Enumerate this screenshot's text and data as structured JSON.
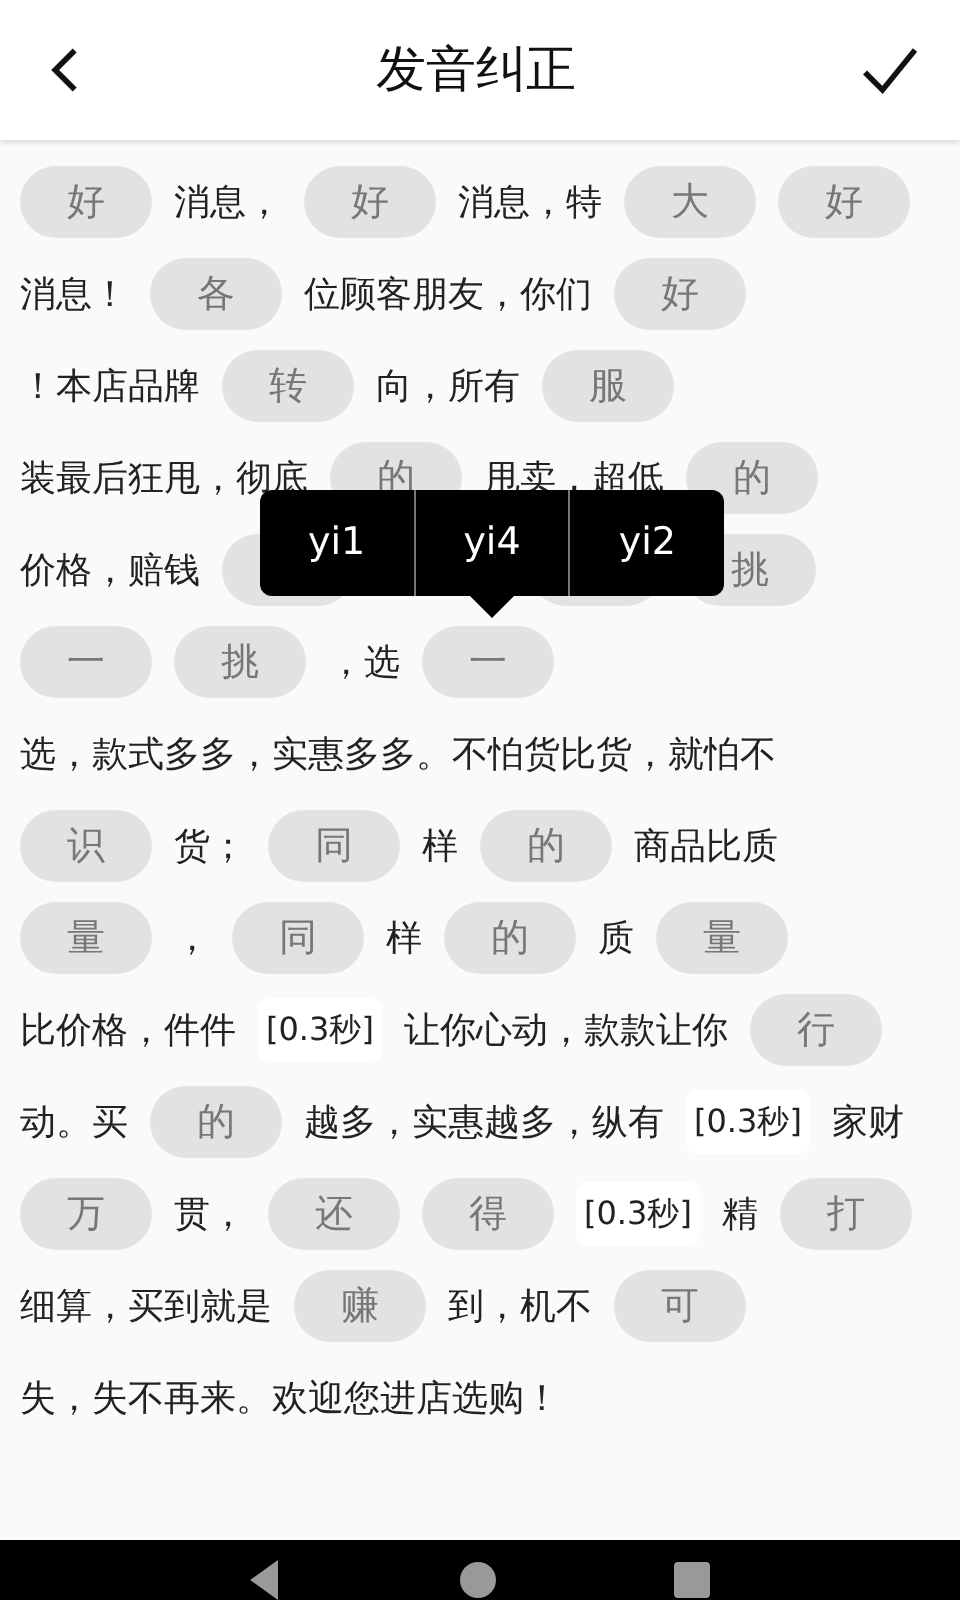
{
  "header": {
    "title": "发音纠正"
  },
  "lines": [
    [
      {
        "kind": "word",
        "text": "好"
      },
      {
        "kind": "text",
        "text": "消息，"
      },
      {
        "kind": "word",
        "text": "好"
      },
      {
        "kind": "text",
        "text": "消息，特"
      },
      {
        "kind": "word",
        "text": "大"
      },
      {
        "kind": "word",
        "text": "好"
      }
    ],
    [
      {
        "kind": "text",
        "text": "消息！"
      },
      {
        "kind": "word",
        "text": "各"
      },
      {
        "kind": "text",
        "text": "位顾客朋友，你们"
      },
      {
        "kind": "word",
        "text": "好"
      }
    ],
    [
      {
        "kind": "text",
        "text": "！本店品牌"
      },
      {
        "kind": "word",
        "text": "转"
      },
      {
        "kind": "text",
        "text": "向，所有"
      },
      {
        "kind": "word",
        "text": "服"
      }
    ],
    [
      {
        "kind": "text",
        "text": "装最后狂甩，彻底"
      },
      {
        "kind": "word",
        "text": "的"
      },
      {
        "kind": "text",
        "text": "甩卖，超低"
      },
      {
        "kind": "word",
        "text": "的"
      }
    ],
    [
      {
        "kind": "text",
        "text": "价格，赔钱"
      },
      {
        "kind": "word"
      },
      {
        "kind": "covered"
      },
      {
        "kind": "word"
      },
      {
        "kind": "word",
        "text": "挑"
      }
    ],
    [
      {
        "kind": "word",
        "text": "一"
      },
      {
        "kind": "word",
        "text": "挑"
      },
      {
        "kind": "text",
        "text": "，选"
      },
      {
        "kind": "word",
        "text": "一"
      }
    ],
    [
      {
        "kind": "text",
        "text": "选，款式多多，实惠多多。不怕货比货，就怕不"
      }
    ],
    [
      {
        "kind": "word",
        "text": "识"
      },
      {
        "kind": "text",
        "text": "货；"
      },
      {
        "kind": "word",
        "text": "同"
      },
      {
        "kind": "text",
        "text": "样"
      },
      {
        "kind": "word",
        "text": "的"
      },
      {
        "kind": "text",
        "text": "商品比质"
      }
    ],
    [
      {
        "kind": "word",
        "text": "量"
      },
      {
        "kind": "text",
        "text": "，"
      },
      {
        "kind": "word",
        "text": "同"
      },
      {
        "kind": "text",
        "text": "样"
      },
      {
        "kind": "word",
        "text": "的"
      },
      {
        "kind": "text",
        "text": "质"
      },
      {
        "kind": "word",
        "text": "量"
      }
    ],
    [
      {
        "kind": "text",
        "text": "比价格，件件"
      },
      {
        "kind": "pause",
        "text": "[0.3秒]"
      },
      {
        "kind": "text",
        "text": "让你心动，款款让你"
      },
      {
        "kind": "word",
        "text": "行"
      }
    ],
    [
      {
        "kind": "text",
        "text": "动。买"
      },
      {
        "kind": "word",
        "text": "的"
      },
      {
        "kind": "text",
        "text": "越多，实惠越多，纵有"
      },
      {
        "kind": "pause",
        "text": "[0.3秒]"
      },
      {
        "kind": "text",
        "text": "家财"
      }
    ],
    [
      {
        "kind": "word",
        "text": "万"
      },
      {
        "kind": "text",
        "text": "贯，"
      },
      {
        "kind": "word",
        "text": "还"
      },
      {
        "kind": "word",
        "text": "得"
      },
      {
        "kind": "pause",
        "text": "[0.3秒]"
      },
      {
        "kind": "text",
        "text": "精"
      },
      {
        "kind": "word",
        "text": "打"
      }
    ],
    [
      {
        "kind": "text",
        "text": "细算，买到就是"
      },
      {
        "kind": "word",
        "text": "赚"
      },
      {
        "kind": "text",
        "text": "到，机不"
      },
      {
        "kind": "word",
        "text": "可"
      }
    ],
    [
      {
        "kind": "text",
        "text": "失，失不再来。欢迎您进店选购！"
      }
    ]
  ],
  "popup": {
    "options": [
      "yi1",
      "yi4",
      "yi2"
    ]
  }
}
